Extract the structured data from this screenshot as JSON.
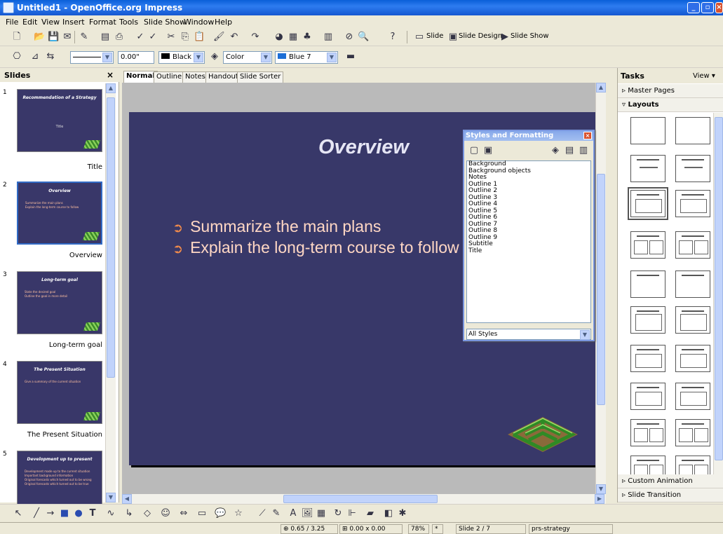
{
  "window": {
    "title": "Untitled1 - OpenOffice.org Impress"
  },
  "menu": [
    "File",
    "Edit",
    "View",
    "Insert",
    "Format",
    "Tools",
    "Slide Show",
    "Window",
    "Help"
  ],
  "toolbar1": {
    "slide": "Slide",
    "slide_design": "Slide Design",
    "slide_show": "Slide Show"
  },
  "toolbar2": {
    "line_width": "0.00\"",
    "line_color": "Black",
    "area_style": "Color",
    "area_color": "Blue 7"
  },
  "slides_panel": {
    "title": "Slides",
    "items": [
      {
        "num": "1",
        "label": "Title",
        "thumb_title": "Recommendation of a Strategy",
        "thumb_sub": "Title",
        "thumb_body": []
      },
      {
        "num": "2",
        "label": "Overview",
        "thumb_title": "Overview",
        "thumb_sub": "",
        "thumb_body": [
          "Summarize the main plans",
          "Explain the long-term course to follow"
        ]
      },
      {
        "num": "3",
        "label": "Long-term goal",
        "thumb_title": "Long-term goal",
        "thumb_sub": "",
        "thumb_body": [
          "State the desired goal",
          "Outline the goal in more detail"
        ]
      },
      {
        "num": "4",
        "label": "The Present Situation",
        "thumb_title": "The Present Situation",
        "thumb_sub": "",
        "thumb_body": [
          "Give a summary of the current situation"
        ]
      },
      {
        "num": "5",
        "label": "",
        "thumb_title": "Development up to present",
        "thumb_sub": "",
        "thumb_body": [
          "Development made up to the current situation",
          "Important background information",
          "Original forecasts which turned out to be wrong",
          "Original forecasts which turned out to be true"
        ]
      }
    ]
  },
  "view_tabs": [
    "Normal",
    "Outline",
    "Notes",
    "Handout",
    "Slide Sorter"
  ],
  "slide": {
    "title": "Overview",
    "bullets": [
      "Summarize the main plans",
      "Explain the long-term course to follow"
    ]
  },
  "styles_dialog": {
    "title": "Styles and Formatting",
    "styles": [
      "Background",
      "Background objects",
      "Notes",
      "Outline 1",
      "Outline 2",
      "Outline 3",
      "Outline 4",
      "Outline 5",
      "Outline 6",
      "Outline 7",
      "Outline 8",
      "Outline 9",
      "Subtitle",
      "Title"
    ],
    "filter": "All Styles"
  },
  "tasks": {
    "title": "Tasks",
    "view": "View",
    "sections": {
      "master_pages": "Master Pages",
      "layouts": "Layouts",
      "custom_animation": "Custom Animation",
      "slide_transition": "Slide Transition"
    }
  },
  "status": {
    "position": "0.65 / 3.25",
    "size": "0.00 x 0.00",
    "zoom": "78%",
    "modified": "*",
    "slide": "Slide 2 / 7",
    "master": "prs-strategy"
  },
  "colors": {
    "slide_bg": "#383869",
    "accent": "#f08a4b",
    "title_bar": "#0a5fd8"
  }
}
